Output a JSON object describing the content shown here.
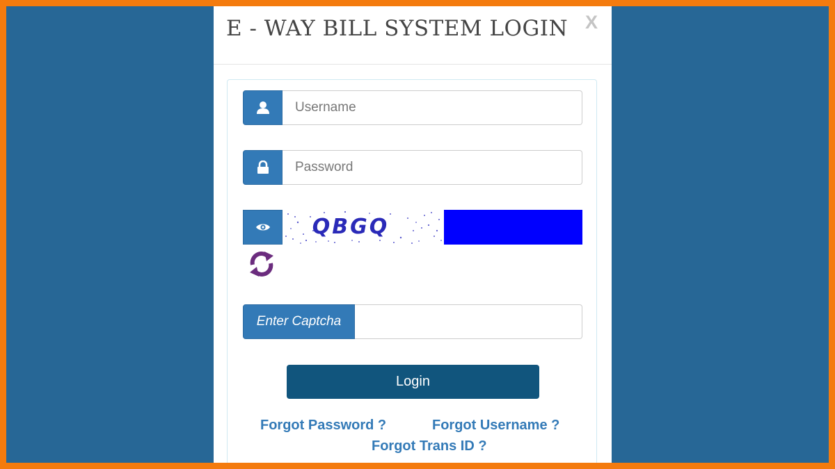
{
  "modal": {
    "title": "E - Way Bill System Login",
    "close_label": "X"
  },
  "form": {
    "username_placeholder": "Username",
    "password_placeholder": "Password",
    "captcha_text": "QBGQ",
    "captcha_label": "Enter Captcha",
    "captcha_value": "",
    "login_label": "Login"
  },
  "links": {
    "forgot_password": "Forgot Password ?",
    "forgot_username": "Forgot Username ?",
    "forgot_trans_id": "Forgot Trans ID ?"
  },
  "colors": {
    "frame": "#f47b0e",
    "backdrop": "#276796",
    "addon": "#337ab7",
    "login_button": "#11557d",
    "captcha_box": "#0000ff",
    "refresh_icon": "#6b2c7e",
    "link": "#337ab7"
  },
  "icons": {
    "username": "user-icon",
    "password": "lock-icon",
    "captcha": "eye-icon",
    "refresh": "refresh-icon"
  }
}
